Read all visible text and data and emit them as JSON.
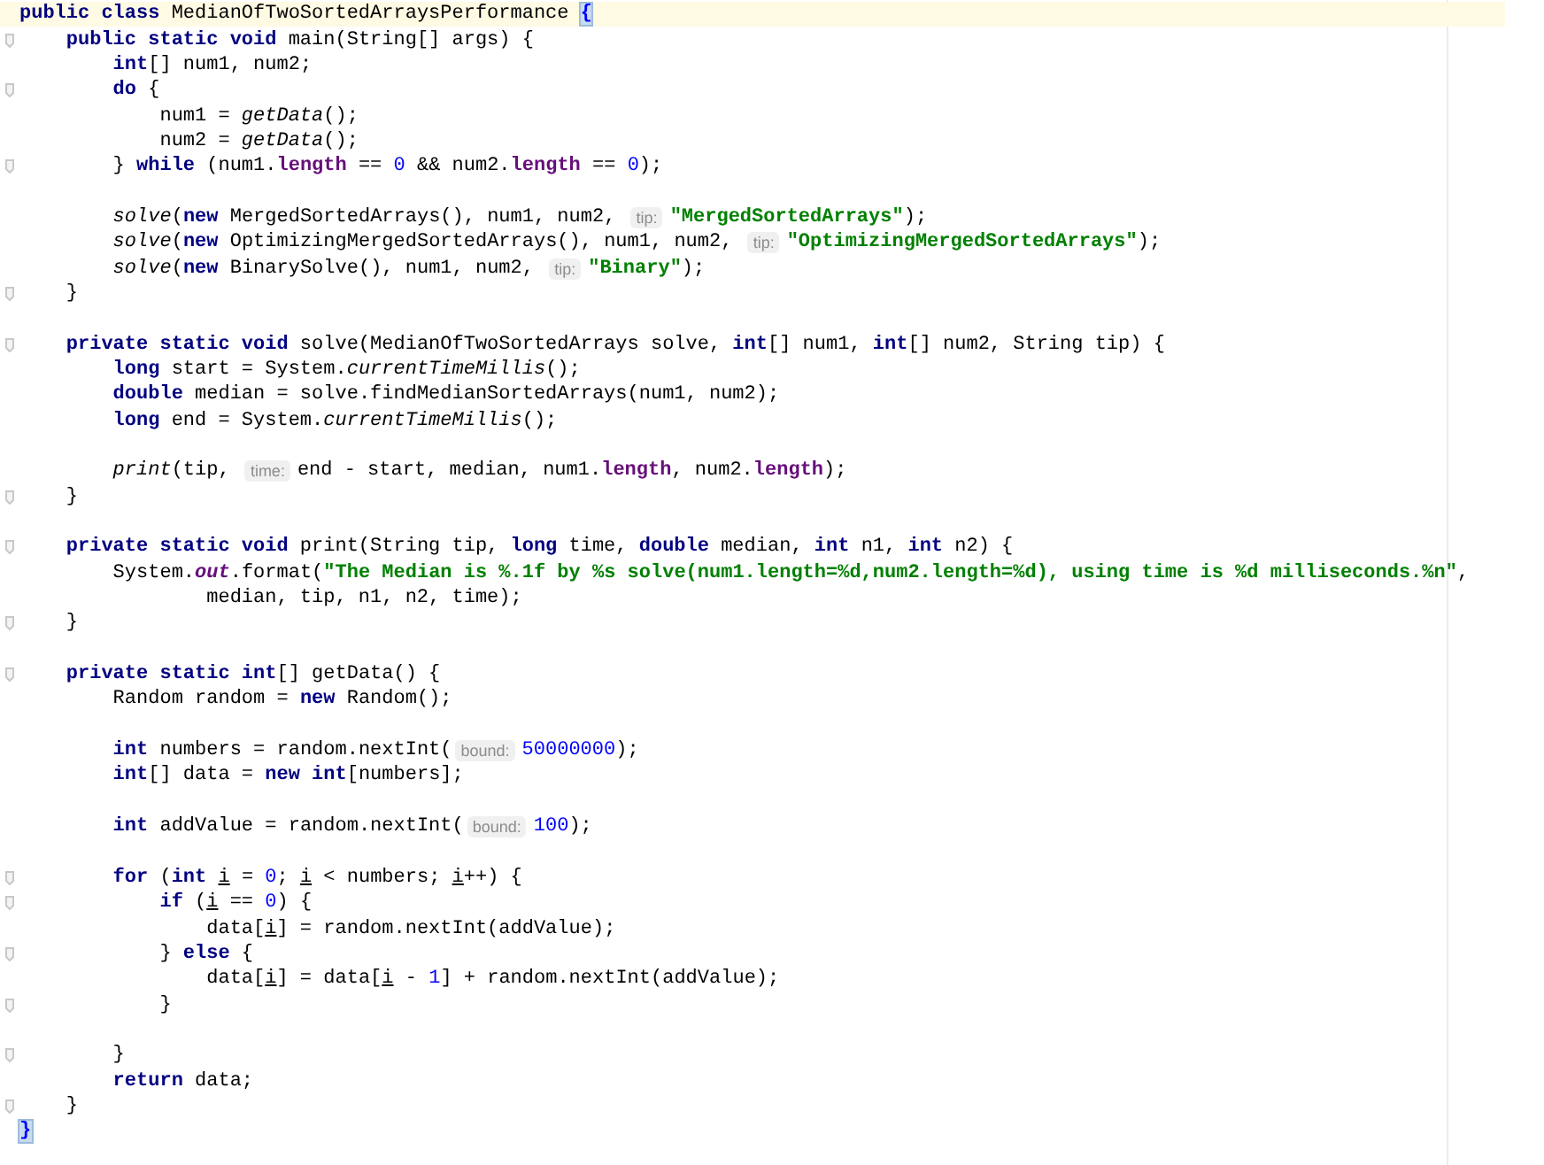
{
  "editor": {
    "lines": [
      {
        "fold": false,
        "current": true,
        "tokens": [
          {
            "kind": "keyword",
            "text": "public class"
          },
          {
            "kind": "plain",
            "text": " MedianOfTwoSortedArraysPerformance "
          },
          {
            "kind": "brace",
            "text": "{"
          }
        ]
      },
      {
        "fold": true,
        "current": false,
        "tokens": [
          {
            "kind": "keyword",
            "text": "    public static void"
          },
          {
            "kind": "plain",
            "text": " main(String[] args) {"
          }
        ]
      },
      {
        "fold": false,
        "current": false,
        "tokens": [
          {
            "kind": "keyword",
            "text": "        int"
          },
          {
            "kind": "plain",
            "text": "[] num1, num2;"
          }
        ]
      },
      {
        "fold": true,
        "current": false,
        "tokens": [
          {
            "kind": "keyword",
            "text": "        do"
          },
          {
            "kind": "plain",
            "text": " {"
          }
        ]
      },
      {
        "fold": false,
        "current": false,
        "tokens": [
          {
            "kind": "plain",
            "text": "            num1 = "
          },
          {
            "kind": "static",
            "text": "getData"
          },
          {
            "kind": "plain",
            "text": "();"
          }
        ]
      },
      {
        "fold": false,
        "current": false,
        "tokens": [
          {
            "kind": "plain",
            "text": "            num2 = "
          },
          {
            "kind": "static",
            "text": "getData"
          },
          {
            "kind": "plain",
            "text": "();"
          }
        ]
      },
      {
        "fold": true,
        "current": false,
        "tokens": [
          {
            "kind": "plain",
            "text": "        } "
          },
          {
            "kind": "keyword",
            "text": "while"
          },
          {
            "kind": "plain",
            "text": " (num1."
          },
          {
            "kind": "field",
            "text": "length"
          },
          {
            "kind": "plain",
            "text": " == "
          },
          {
            "kind": "number",
            "text": "0"
          },
          {
            "kind": "plain",
            "text": " && num2."
          },
          {
            "kind": "field",
            "text": "length"
          },
          {
            "kind": "plain",
            "text": " == "
          },
          {
            "kind": "number",
            "text": "0"
          },
          {
            "kind": "plain",
            "text": ");"
          }
        ]
      },
      {
        "fold": false,
        "current": false
      },
      {
        "fold": false,
        "current": false,
        "tokens": [
          {
            "kind": "static",
            "text": "        solve"
          },
          {
            "kind": "plain",
            "text": "("
          },
          {
            "kind": "keyword",
            "text": "new"
          },
          {
            "kind": "plain",
            "text": " MergedSortedArrays(), num1, num2, "
          },
          {
            "kind": "hint",
            "text": "tip:"
          },
          {
            "kind": "string",
            "text": "\"MergedSortedArrays\""
          },
          {
            "kind": "plain",
            "text": ");"
          }
        ]
      },
      {
        "fold": false,
        "current": false,
        "tokens": [
          {
            "kind": "static",
            "text": "        solve"
          },
          {
            "kind": "plain",
            "text": "("
          },
          {
            "kind": "keyword",
            "text": "new"
          },
          {
            "kind": "plain",
            "text": " OptimizingMergedSortedArrays(), num1, num2, "
          },
          {
            "kind": "hint",
            "text": "tip:"
          },
          {
            "kind": "string",
            "text": "\"OptimizingMergedSortedArrays\""
          },
          {
            "kind": "plain",
            "text": ");"
          }
        ]
      },
      {
        "fold": false,
        "current": false,
        "tokens": [
          {
            "kind": "static",
            "text": "        solve"
          },
          {
            "kind": "plain",
            "text": "("
          },
          {
            "kind": "keyword",
            "text": "new"
          },
          {
            "kind": "plain",
            "text": " BinarySolve(), num1, num2, "
          },
          {
            "kind": "hint",
            "text": "tip:"
          },
          {
            "kind": "string",
            "text": "\"Binary\""
          },
          {
            "kind": "plain",
            "text": ");"
          }
        ]
      },
      {
        "fold": true,
        "current": false,
        "tokens": [
          {
            "kind": "plain",
            "text": "    }"
          }
        ]
      },
      {
        "fold": false,
        "current": false
      },
      {
        "fold": true,
        "current": false,
        "tokens": [
          {
            "kind": "keyword",
            "text": "    private static void"
          },
          {
            "kind": "plain",
            "text": " solve(MedianOfTwoSortedArrays solve, "
          },
          {
            "kind": "keyword",
            "text": "int"
          },
          {
            "kind": "plain",
            "text": "[] num1, "
          },
          {
            "kind": "keyword",
            "text": "int"
          },
          {
            "kind": "plain",
            "text": "[] num2, String tip) {"
          }
        ]
      },
      {
        "fold": false,
        "current": false,
        "tokens": [
          {
            "kind": "keyword",
            "text": "        long"
          },
          {
            "kind": "plain",
            "text": " start = System."
          },
          {
            "kind": "static",
            "text": "currentTimeMillis"
          },
          {
            "kind": "plain",
            "text": "();"
          }
        ]
      },
      {
        "fold": false,
        "current": false,
        "tokens": [
          {
            "kind": "keyword",
            "text": "        double"
          },
          {
            "kind": "plain",
            "text": " median = solve.findMedianSortedArrays(num1, num2);"
          }
        ]
      },
      {
        "fold": false,
        "current": false,
        "tokens": [
          {
            "kind": "keyword",
            "text": "        long"
          },
          {
            "kind": "plain",
            "text": " end = System."
          },
          {
            "kind": "static",
            "text": "currentTimeMillis"
          },
          {
            "kind": "plain",
            "text": "();"
          }
        ]
      },
      {
        "fold": false,
        "current": false
      },
      {
        "fold": false,
        "current": false,
        "tokens": [
          {
            "kind": "static",
            "text": "        print"
          },
          {
            "kind": "plain",
            "text": "(tip, "
          },
          {
            "kind": "hint",
            "text": "time:"
          },
          {
            "kind": "plain",
            "text": "end - start, median, num1."
          },
          {
            "kind": "field",
            "text": "length"
          },
          {
            "kind": "plain",
            "text": ", num2."
          },
          {
            "kind": "field",
            "text": "length"
          },
          {
            "kind": "plain",
            "text": ");"
          }
        ]
      },
      {
        "fold": true,
        "current": false,
        "tokens": [
          {
            "kind": "plain",
            "text": "    }"
          }
        ]
      },
      {
        "fold": false,
        "current": false
      },
      {
        "fold": true,
        "current": false,
        "tokens": [
          {
            "kind": "keyword",
            "text": "    private static void"
          },
          {
            "kind": "plain",
            "text": " print(String tip, "
          },
          {
            "kind": "keyword",
            "text": "long"
          },
          {
            "kind": "plain",
            "text": " time, "
          },
          {
            "kind": "keyword",
            "text": "double"
          },
          {
            "kind": "plain",
            "text": " median, "
          },
          {
            "kind": "keyword",
            "text": "int"
          },
          {
            "kind": "plain",
            "text": " n1, "
          },
          {
            "kind": "keyword",
            "text": "int"
          },
          {
            "kind": "plain",
            "text": " n2) {"
          }
        ]
      },
      {
        "fold": false,
        "current": false,
        "tokens": [
          {
            "kind": "plain",
            "text": "        System."
          },
          {
            "kind": "static-field",
            "text": "out"
          },
          {
            "kind": "plain",
            "text": ".format("
          },
          {
            "kind": "string",
            "text": "\"The Median is %.1f by %s solve(num1.length=%d,num2.length=%d), using time is %d milliseconds.%n\""
          },
          {
            "kind": "plain",
            "text": ","
          }
        ]
      },
      {
        "fold": false,
        "current": false,
        "tokens": [
          {
            "kind": "plain",
            "text": "                median, tip, n1, n2, time);"
          }
        ]
      },
      {
        "fold": true,
        "current": false,
        "tokens": [
          {
            "kind": "plain",
            "text": "    }"
          }
        ]
      },
      {
        "fold": false,
        "current": false
      },
      {
        "fold": true,
        "current": false,
        "tokens": [
          {
            "kind": "keyword",
            "text": "    private static int"
          },
          {
            "kind": "plain",
            "text": "[] getData() {"
          }
        ]
      },
      {
        "fold": false,
        "current": false,
        "tokens": [
          {
            "kind": "plain",
            "text": "        Random random = "
          },
          {
            "kind": "keyword",
            "text": "new"
          },
          {
            "kind": "plain",
            "text": " Random();"
          }
        ]
      },
      {
        "fold": false,
        "current": false
      },
      {
        "fold": false,
        "current": false,
        "tokens": [
          {
            "kind": "keyword",
            "text": "        int"
          },
          {
            "kind": "plain",
            "text": " numbers = random.nextInt("
          },
          {
            "kind": "hint",
            "text": "bound:"
          },
          {
            "kind": "number",
            "text": "50000000"
          },
          {
            "kind": "plain",
            "text": ");"
          }
        ]
      },
      {
        "fold": false,
        "current": false,
        "tokens": [
          {
            "kind": "keyword",
            "text": "        int"
          },
          {
            "kind": "plain",
            "text": "[] data = "
          },
          {
            "kind": "keyword",
            "text": "new int"
          },
          {
            "kind": "plain",
            "text": "[numbers];"
          }
        ]
      },
      {
        "fold": false,
        "current": false
      },
      {
        "fold": false,
        "current": false,
        "tokens": [
          {
            "kind": "keyword",
            "text": "        int"
          },
          {
            "kind": "plain",
            "text": " addValue = random.nextInt("
          },
          {
            "kind": "hint",
            "text": "bound:"
          },
          {
            "kind": "number",
            "text": "100"
          },
          {
            "kind": "plain",
            "text": ");"
          }
        ]
      },
      {
        "fold": false,
        "current": false
      },
      {
        "fold": true,
        "current": false,
        "tokens": [
          {
            "kind": "keyword",
            "text": "        for"
          },
          {
            "kind": "plain",
            "text": " ("
          },
          {
            "kind": "keyword",
            "text": "int "
          },
          {
            "kind": "reassigned",
            "text": "i"
          },
          {
            "kind": "plain",
            "text": " = "
          },
          {
            "kind": "number",
            "text": "0"
          },
          {
            "kind": "plain",
            "text": "; "
          },
          {
            "kind": "reassigned",
            "text": "i"
          },
          {
            "kind": "plain",
            "text": " < numbers; "
          },
          {
            "kind": "reassigned",
            "text": "i"
          },
          {
            "kind": "plain",
            "text": "++) {"
          }
        ]
      },
      {
        "fold": true,
        "current": false,
        "tokens": [
          {
            "kind": "keyword",
            "text": "            if"
          },
          {
            "kind": "plain",
            "text": " ("
          },
          {
            "kind": "reassigned",
            "text": "i"
          },
          {
            "kind": "plain",
            "text": " == "
          },
          {
            "kind": "number",
            "text": "0"
          },
          {
            "kind": "plain",
            "text": ") {"
          }
        ]
      },
      {
        "fold": false,
        "current": false,
        "tokens": [
          {
            "kind": "plain",
            "text": "                data["
          },
          {
            "kind": "reassigned",
            "text": "i"
          },
          {
            "kind": "plain",
            "text": "] = random.nextInt(addValue);"
          }
        ]
      },
      {
        "fold": true,
        "current": false,
        "tokens": [
          {
            "kind": "plain",
            "text": "            } "
          },
          {
            "kind": "keyword",
            "text": "else"
          },
          {
            "kind": "plain",
            "text": " {"
          }
        ]
      },
      {
        "fold": false,
        "current": false,
        "tokens": [
          {
            "kind": "plain",
            "text": "                data["
          },
          {
            "kind": "reassigned",
            "text": "i"
          },
          {
            "kind": "plain",
            "text": "] = data["
          },
          {
            "kind": "reassigned",
            "text": "i"
          },
          {
            "kind": "plain",
            "text": " - "
          },
          {
            "kind": "number",
            "text": "1"
          },
          {
            "kind": "plain",
            "text": "] + random.nextInt(addValue);"
          }
        ]
      },
      {
        "fold": true,
        "current": false,
        "tokens": [
          {
            "kind": "plain",
            "text": "            }"
          }
        ]
      },
      {
        "fold": false,
        "current": false
      },
      {
        "fold": true,
        "current": false,
        "tokens": [
          {
            "kind": "plain",
            "text": "        }"
          }
        ]
      },
      {
        "fold": false,
        "current": false,
        "tokens": [
          {
            "kind": "keyword",
            "text": "        return"
          },
          {
            "kind": "plain",
            "text": " data;"
          }
        ]
      },
      {
        "fold": true,
        "current": false,
        "tokens": [
          {
            "kind": "plain",
            "text": "    }"
          }
        ]
      },
      {
        "fold": false,
        "current": false,
        "tokens": [
          {
            "kind": "brace",
            "text": "}"
          }
        ]
      }
    ]
  }
}
